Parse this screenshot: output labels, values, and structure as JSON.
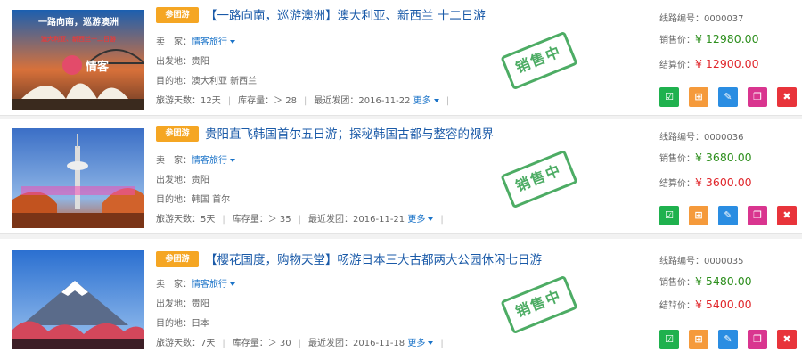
{
  "labels": {
    "seller": "卖　家：",
    "departure": "出发地：",
    "destination": "目的地：",
    "days": "旅游天数：",
    "stock": "库存量：",
    "recent": "最近发团：",
    "more": "更多",
    "code": "线路编号：",
    "sale_price": "销售价：",
    "settle_price": "结算价：",
    "stamp": "销售中"
  },
  "icons": {
    "confirm": "check-square-icon",
    "cart": "cart-icon",
    "edit": "edit-icon",
    "copy": "copy-icon",
    "delete": "trash-icon"
  },
  "colors": {
    "tag": "#f5a623",
    "title": "#1a5aa8",
    "sale": "#2e8f1e",
    "settle": "#e0262b",
    "stamp": "#2e9e4a"
  },
  "tours": [
    {
      "tag": "参团游",
      "title": "【一路向南，巡游澳洲】澳大利亚、新西兰 十二日游",
      "seller": "情客旅行",
      "departure": "贵阳",
      "destination": "澳大利亚 新西兰",
      "days": "12天",
      "stock": "＞ 28",
      "recent": "2016-11-22",
      "code": "0000037",
      "sale": "¥ 12980.00",
      "settle": "¥ 12900.00",
      "thumb_caption_1": "一路向南，巡游澳洲",
      "thumb_caption_2": "澳大利亚、新西兰十二日游",
      "thumb_logo": "情客"
    },
    {
      "tag": "参团游",
      "title": "贵阳直飞韩国首尔五日游；探秘韩国古都与整容的视界",
      "seller": "情客旅行",
      "departure": "贵阳",
      "destination": "韩国 首尔",
      "days": "5天",
      "stock": "＞ 35",
      "recent": "2016-11-21",
      "code": "0000036",
      "sale": "¥ 3680.00",
      "settle": "¥ 3600.00",
      "thumb_caption_1": "",
      "thumb_caption_2": "",
      "thumb_logo": ""
    },
    {
      "tag": "参团游",
      "title": "【樱花国度，购物天堂】畅游日本三大古都两大公园休闲七日游",
      "seller": "情客旅行",
      "departure": "贵阳",
      "destination": "日本",
      "days": "7天",
      "stock": "＞ 30",
      "recent": "2016-11-18",
      "code": "0000035",
      "sale": "¥ 5480.00",
      "settle": "¥ 5400.00",
      "thumb_caption_1": "",
      "thumb_caption_2": "",
      "thumb_logo": ""
    }
  ]
}
